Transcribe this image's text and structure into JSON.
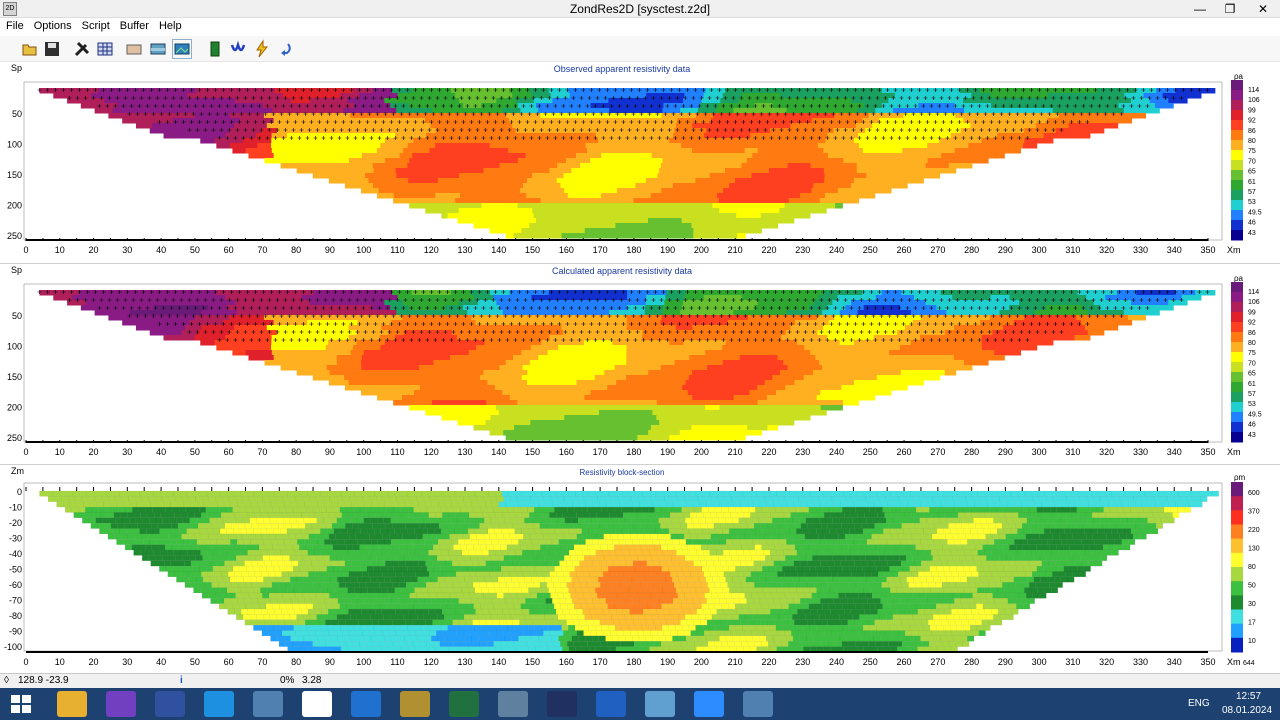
{
  "window": {
    "title": "ZondRes2D [sysctest.z2d]",
    "icon_text": "2D"
  },
  "menu": [
    "File",
    "Options",
    "Script",
    "Buffer",
    "Help"
  ],
  "toolbar_icons": [
    "open-icon",
    "save-icon",
    "tools-icon",
    "table-icon",
    "model-icon",
    "section-icon",
    "image-icon",
    "battery-icon",
    "inversion-icon",
    "lightning-icon",
    "undo-icon"
  ],
  "panels": [
    {
      "title": "Observed apparent resistivity data",
      "y_axis_label": "Sp",
      "x_unit": "Xm",
      "y_ticks": [
        "50",
        "100",
        "150",
        "200",
        "250"
      ],
      "scale_unit": "ρa",
      "scale_values": [
        "114",
        "106",
        "99",
        "92",
        "86",
        "80",
        "75",
        "70",
        "65",
        "61",
        "57",
        "53",
        "49.5",
        "46",
        "43"
      ]
    },
    {
      "title": "Calculated apparent resistivity data",
      "y_axis_label": "Sp",
      "x_unit": "Xm",
      "y_ticks": [
        "50",
        "100",
        "150",
        "200",
        "250"
      ],
      "scale_unit": "ρa",
      "scale_values": [
        "114",
        "106",
        "99",
        "92",
        "86",
        "80",
        "75",
        "70",
        "65",
        "61",
        "57",
        "53",
        "49.5",
        "46",
        "43"
      ]
    },
    {
      "title": "Resistivity block-section",
      "y_axis_label": "Zm",
      "x_unit": "Xm",
      "y_ticks": [
        "0",
        "-10",
        "-20",
        "-30",
        "-40",
        "-50",
        "-60",
        "-70",
        "-80",
        "-90",
        "-100"
      ],
      "scale_unit": "ρm",
      "scale_values": [
        "600",
        "370",
        "220",
        "130",
        "80",
        "50",
        "30",
        "17",
        "10"
      ],
      "scale_extra": "644"
    }
  ],
  "x_ticks": [
    "0",
    "10",
    "20",
    "30",
    "40",
    "50",
    "60",
    "70",
    "80",
    "90",
    "100",
    "110",
    "120",
    "130",
    "140",
    "150",
    "160",
    "170",
    "180",
    "190",
    "200",
    "210",
    "220",
    "230",
    "240",
    "250",
    "260",
    "270",
    "280",
    "290",
    "300",
    "310",
    "320",
    "330",
    "340",
    "350"
  ],
  "status": {
    "coords": "128.9 -23.9",
    "progress": "0%",
    "value": "3.28"
  },
  "taskbar": {
    "apps": [
      "windows-icon",
      "explorer-icon",
      "viber-icon",
      "calculator-icon",
      "skype-icon",
      "paint-icon",
      "chrome-icon",
      "ie-icon",
      "sevenzip-icon",
      "excel-icon",
      "mathcad-icon",
      "floppy-icon",
      "help-icon",
      "notes-icon",
      "zoom-icon",
      "network-icon"
    ],
    "lang": "ENG",
    "time": "12:57",
    "date": "08.01.2024"
  },
  "colors": {
    "observed_palette": [
      "#6a1b7a",
      "#8a1a84",
      "#b01f5a",
      "#e0202a",
      "#ff4020",
      "#ff7a10",
      "#ffb020",
      "#ffff00",
      "#c8e020",
      "#66c030",
      "#2ea830",
      "#1aa060",
      "#20d0d0",
      "#2080ff",
      "#1030d0",
      "#080090"
    ],
    "block_palette": [
      "#6a1b7a",
      "#c02050",
      "#ff3020",
      "#ff8020",
      "#ffc030",
      "#ffff30",
      "#a8d840",
      "#3cc040",
      "#1e8a30",
      "#40e0e0",
      "#20a0ff",
      "#0820c0"
    ]
  }
}
